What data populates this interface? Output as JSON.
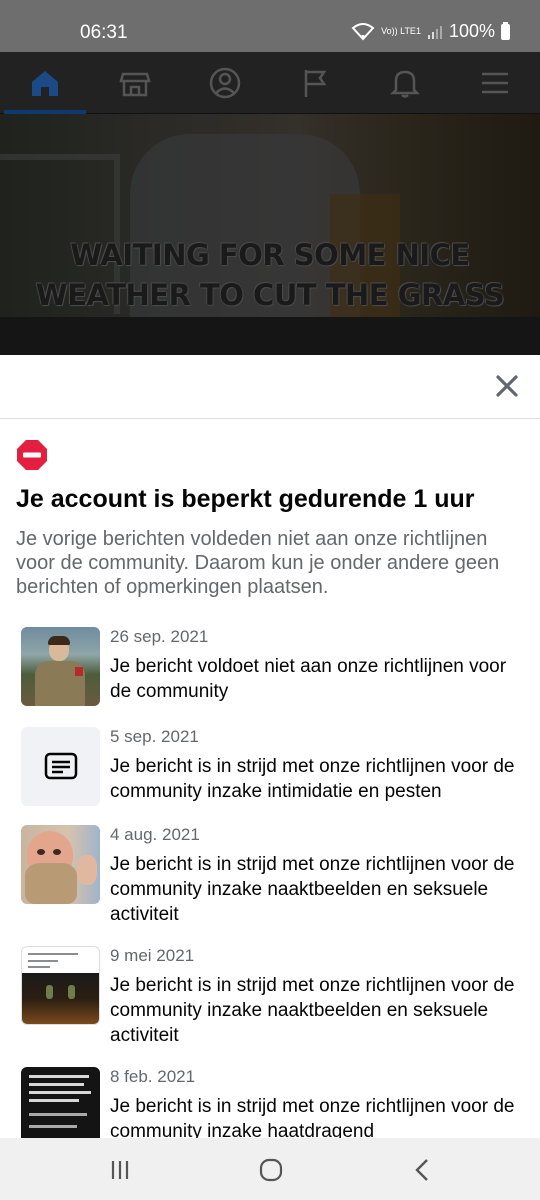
{
  "status_bar": {
    "time": "06:31",
    "network_label": "Vo)) LTE1",
    "battery": "100%"
  },
  "app_nav": {
    "items": [
      {
        "icon": "home-icon",
        "active": true
      },
      {
        "icon": "marketplace-icon",
        "active": false
      },
      {
        "icon": "profile-icon",
        "active": false
      },
      {
        "icon": "pages-flag-icon",
        "active": false
      },
      {
        "icon": "notifications-bell-icon",
        "active": false
      },
      {
        "icon": "menu-icon",
        "active": false
      }
    ]
  },
  "background_video": {
    "caption_line1": "WAITING FOR SOME NICE",
    "caption_line2": "WEATHER  TO CUT THE GRASS"
  },
  "sheet": {
    "close_icon": "close-icon",
    "alert_icon": "stop-icon",
    "alert_color": "#e41e3f",
    "title": "Je account is beperkt gedurende 1 uur",
    "description": "Je vorige berichten voldeden niet aan onze richtlijnen voor de community. Daarom kun je onder andere geen berichten of opmerkingen plaatsen.",
    "violations": [
      {
        "date": "26 sep. 2021",
        "message": "Je bericht voldoet niet aan onze richtlijnen voor de community",
        "thumbnail": "photo-thumbnail"
      },
      {
        "date": "5 sep. 2021",
        "message": "Je bericht is in strijd met onze richtlijnen voor de community inzake intimidatie en pesten",
        "thumbnail": "text-post-icon"
      },
      {
        "date": "4 aug. 2021",
        "message": "Je bericht is in strijd met onze richtlijnen voor de community inzake naaktbeelden en seksuele activiteit",
        "thumbnail": "photo-thumbnail"
      },
      {
        "date": "9 mei 2021",
        "message": "Je bericht is in strijd met onze richtlijnen voor de community inzake naaktbeelden en seksuele activiteit",
        "thumbnail": "post-screenshot-thumbnail"
      },
      {
        "date": "8 feb. 2021",
        "message": "Je bericht is in strijd met onze richtlijnen voor de community inzake haatdragend",
        "thumbnail": "text-image-thumbnail"
      }
    ]
  },
  "system_nav": {
    "recents_icon": "recents-icon",
    "home_icon": "home-circle-icon",
    "back_icon": "back-icon"
  }
}
